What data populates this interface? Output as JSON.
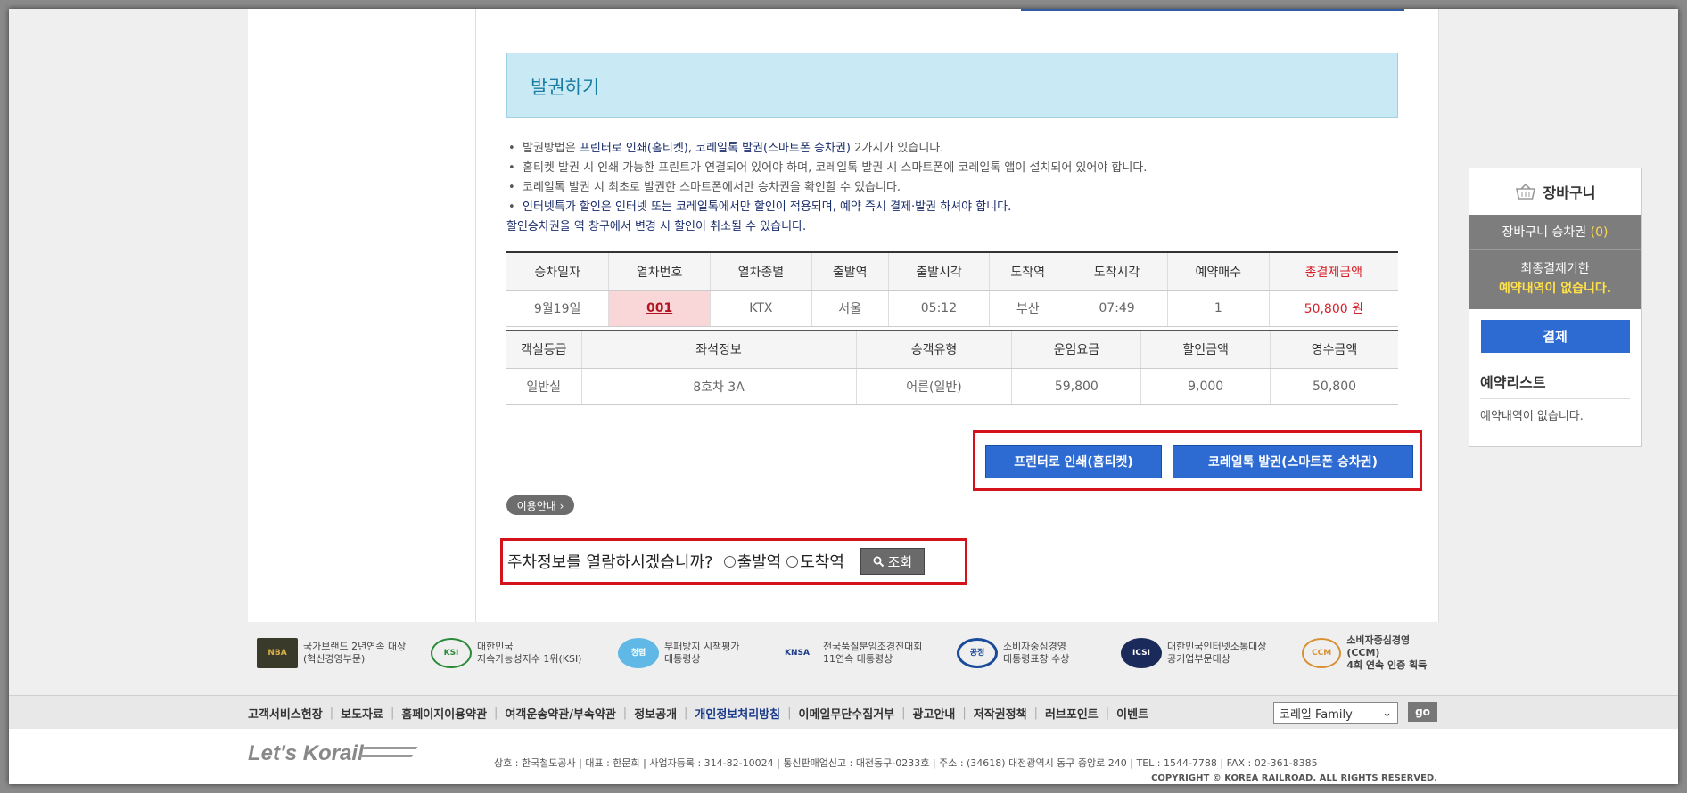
{
  "section": {
    "title": "발권하기"
  },
  "notes": {
    "n1_prefix": "발권방법은 ",
    "n1_bold": "프린터로 인쇄(홈티켓), 코레일톡 발권(스마트폰 승차권)",
    "n1_suffix": " 2가지가 있습니다.",
    "n2": "홈티켓 발권 시 인쇄 가능한 프린트가 연결되어 있어야 하며, 코레일톡 발권 시 스마트폰에 코레일톡 앱이 설치되어 있어야 합니다.",
    "n3": "코레일톡 발권 시 최초로 발권한 스마트폰에서만 승차권을 확인할 수 있습니다.",
    "n4": "인터넷특가 할인은 인터넷 또는 코레일톡에서만 할인이 적용되며, 예약 즉시 결제·발권 하셔야 합니다.",
    "n5": "할인승차권을 역 창구에서 변경 시 할인이 취소될 수 있습니다."
  },
  "train_table": {
    "headers": [
      "승차일자",
      "열차번호",
      "열차종별",
      "출발역",
      "출발시각",
      "도착역",
      "도착시각",
      "예약매수",
      "총결제금액"
    ],
    "row": {
      "date": "9월19일",
      "train_no": "001",
      "type": "KTX",
      "dep": "서울",
      "dep_time": "05:12",
      "arr": "부산",
      "arr_time": "07:49",
      "count": "1",
      "total": "50,800 원"
    }
  },
  "seat_table": {
    "headers": [
      "객실등급",
      "좌석정보",
      "승객유형",
      "운임요금",
      "할인금액",
      "영수금액"
    ],
    "row": {
      "class": "일반실",
      "seat": "8호차 3A",
      "passenger": "어른(일반)",
      "fare": "59,800",
      "discount": "9,000",
      "receipt": "50,800"
    }
  },
  "buttons": {
    "print": "프린터로 인쇄(홈티켓)",
    "korail_talk": "코레일톡 발권(스마트폰 승차권)"
  },
  "guide": {
    "label": "이용안내 ›"
  },
  "parking": {
    "question": "주차정보를 열람하시겠습니까?",
    "opt_dep": "출발역",
    "opt_arr": "도착역",
    "lookup": "조회"
  },
  "cart": {
    "title": "장바구니",
    "count_label": "장바구니 승차권 ",
    "count_value": "(0)",
    "deadline_label": "최종결제기한",
    "deadline_value": "예약내역이 없습니다.",
    "pay": "결제",
    "res_title": "예약리스트",
    "res_empty": "예약내역이 없습니다."
  },
  "awards": [
    {
      "logo": "NBA",
      "l1": "국가브랜드 2년연속 대상",
      "l2": "(혁신경영부문)"
    },
    {
      "logo": "KSI",
      "l1": "대한민국",
      "l2": "지속가능성지수 1위(KSI)"
    },
    {
      "logo": "청렴",
      "l1": "부패방지 시책평가",
      "l2": "대통령상"
    },
    {
      "logo": "KNSA",
      "l1": "전국품질분임조경진대회",
      "l2": "11연속 대통령상"
    },
    {
      "logo": "공정",
      "l1": "소비자중심경영",
      "l2": "대통령표창 수상"
    },
    {
      "logo": "ICSI",
      "l1": "대한민국인터넷소통대상",
      "l2": "공기업부문대상"
    },
    {
      "logo": "CCM",
      "l1": "소비자중심경영(CCM)",
      "l2": "4회 연속 인증 획득"
    }
  ],
  "footer_links": [
    "고객서비스헌장",
    "보도자료",
    "홈페이지이용약관",
    "여객운송약관/부속약관",
    "정보공개",
    "개인정보처리방침",
    "이메일무단수집거부",
    "광고안내",
    "저작권정책",
    "러브포인트",
    "이벤트"
  ],
  "family": {
    "selected": "코레일 Family",
    "go": "go"
  },
  "brand": "Let's Korail",
  "address": "상호 : 한국철도공사  |  대표 : 한문희  |  사업자등록 : 314-82-10024  |  통신판매업신고 : 대전동구-0233호  |  주소 : (34618) 대전광역시 동구 중앙로 240  |  TEL : 1544-7788  |  FAX : 02-361-8385",
  "copyright": "COPYRIGHT © KOREA RAILROAD. ALL RIGHTS RESERVED."
}
